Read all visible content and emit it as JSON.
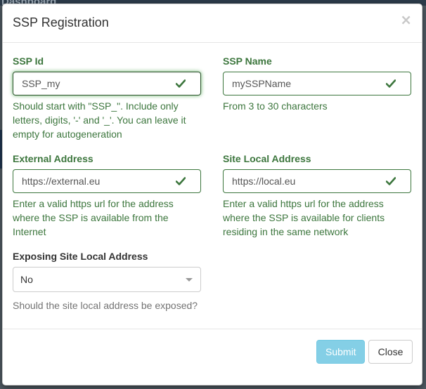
{
  "backdrop": {
    "title": "Dashboard"
  },
  "modal": {
    "title": "SSP Registration",
    "close_label": "×"
  },
  "form": {
    "ssp_id": {
      "label": "SSP Id",
      "value": "SSP_my",
      "help": "Should start with \"SSP_\". Include only letters, digits, '-' and '_'. You can leave it empty for autogeneration"
    },
    "ssp_name": {
      "label": "SSP Name",
      "value": "mySSPName",
      "help": "From 3 to 30 characters"
    },
    "external_address": {
      "label": "External Address",
      "value": "https://external.eu",
      "help": "Enter a valid https url for the address where the SSP is available from the Internet"
    },
    "site_local_address": {
      "label": "Site Local Address",
      "value": "https://local.eu",
      "help": "Enter a valid https url for the address where the SSP is available for clients residing in the same network"
    },
    "exposing": {
      "label": "Exposing Site Local Address",
      "selected": "No",
      "help": "Should the site local address be exposed?"
    }
  },
  "footer": {
    "submit_label": "Submit",
    "close_label": "Close"
  },
  "colors": {
    "success": "#3c763d",
    "info_button": "#5bc0de",
    "help_muted": "#737373"
  },
  "icons": {
    "valid": "check-icon",
    "dismiss": "close-icon",
    "dropdown": "caret-down-icon"
  }
}
